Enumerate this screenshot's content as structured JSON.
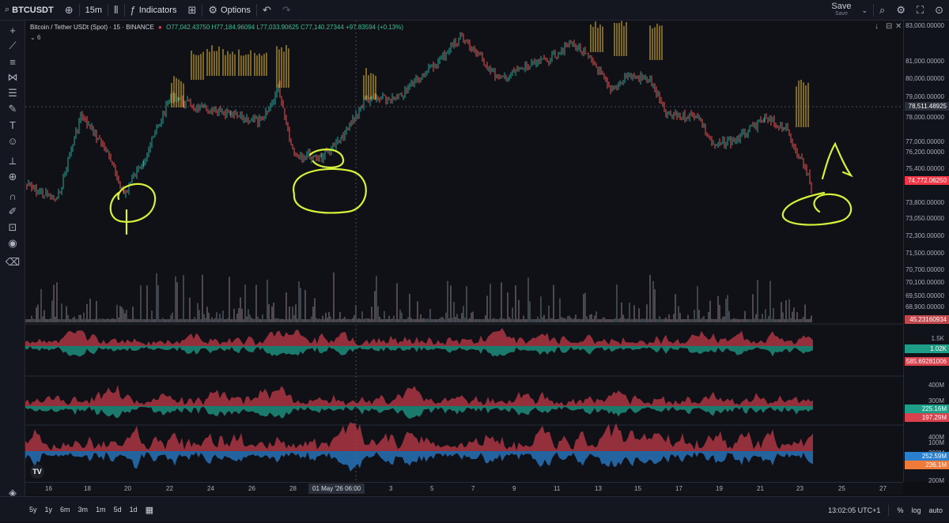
{
  "toolbar": {
    "symbol": "BTCUSDT",
    "interval": "15m",
    "indicators_label": "Indicators",
    "options_label": "Options",
    "save_label": "Save",
    "save_sub": "Save"
  },
  "legend": {
    "title": "Bitcoin / Tether USDt (Spot) · 15 · BINANCE",
    "o": "O77,042.43750",
    "h": "H77,184.96094",
    "l": "L77,033.90625",
    "c": "C77,140.27344",
    "change": "+97.83594 (+0.13%)",
    "sub": "6"
  },
  "price_axis": {
    "labels": [
      "83,000.00000",
      "81,000.00000",
      "80,000.00000",
      "79,000.00000",
      "78,000.00000",
      "77,000.00000",
      "76,200.00000",
      "75,400.00000",
      "73,800.00000",
      "73,050.00000",
      "72,300.00000",
      "71,500.00000",
      "70,700.00000",
      "70,100.00000",
      "69,500.00000",
      "68,900.00000",
      "1.5K",
      "400M",
      "300M",
      "400M",
      "300M",
      "200M",
      "100M"
    ],
    "crosshair_price": "78,511.48925",
    "last_price": "74,772.06250",
    "volume_badge": "45.23160934",
    "ind1_badge_a": "1.02K",
    "ind1_badge_b": "585.69281006",
    "ind2_badge_a": "225.16M",
    "ind2_badge_b": "197.29M",
    "ind3_badge_a": "252.59M",
    "ind3_badge_b": "236.1M",
    "colors": {
      "last_price": "#f23645",
      "up": "#26a69a",
      "down": "#ef5350",
      "crosshair_badge": "#2a2e39"
    }
  },
  "time_axis": {
    "labels": [
      "16",
      "18",
      "20",
      "22",
      "24",
      "26",
      "28",
      "3",
      "5",
      "7",
      "9",
      "11",
      "13",
      "15",
      "17",
      "19",
      "21",
      "23",
      "25",
      "27"
    ],
    "cursor_label": "01 May '26  06:00"
  },
  "bottombar": {
    "ranges": [
      "5y",
      "1y",
      "6m",
      "3m",
      "1m",
      "5d",
      "1d"
    ],
    "clock": "13:02:05 UTC+1",
    "percent": "%",
    "log": "log",
    "auto": "auto"
  },
  "logo_text": "TV"
}
